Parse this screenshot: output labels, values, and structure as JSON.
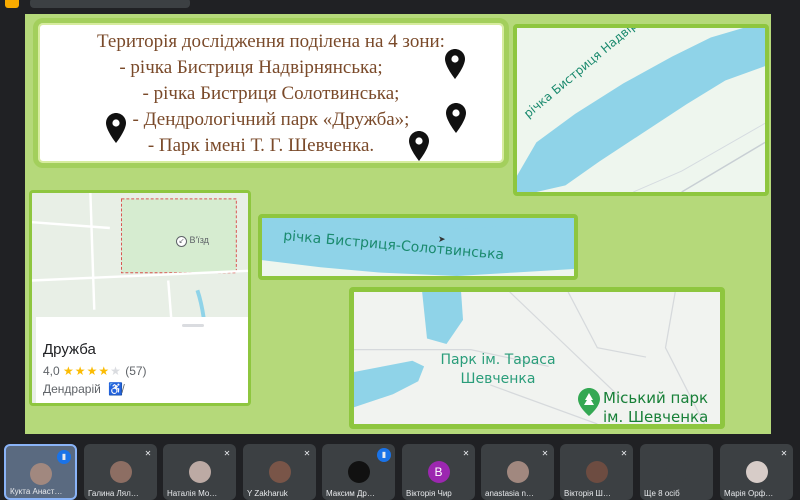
{
  "window": {
    "title": ""
  },
  "slide": {
    "heading": "Територія дослідження поділена на 4 зони:",
    "zones": [
      "- річка Бистриця Надвірнянська;",
      "- річка Бистриця Солотвинська;",
      "- Дендрологічний парк «Дружба»;",
      "- Парк імені Т. Г. Шевченка."
    ],
    "maps": {
      "river_nadvirnyanska": {
        "label": "річка Бистриця Надвірнянська"
      },
      "river_solotvynska": {
        "label": "річка Бистриця-Солотвинська"
      },
      "dendropark": {
        "entrance_label": "В'їзд",
        "card": {
          "name": "Дружба",
          "rating": "4,0",
          "review_count": "(57)",
          "category": "Дендрарій",
          "stars_filled": 4,
          "stars_total": 5
        }
      },
      "park_shevchenko": {
        "label_line1": "Парк ім. Тараса",
        "label_line2": "Шевченка",
        "poi_line1": "Міський парк",
        "poi_line2": "ім. Шевченка"
      }
    }
  },
  "participants": [
    {
      "name": "Кукта Анаст…",
      "initial": "",
      "mic": "on",
      "active": true,
      "avatar_color": "#a1887f"
    },
    {
      "name": "Галина Лял…",
      "initial": "",
      "mic": "off",
      "active": false,
      "avatar_color": "#8d6e63"
    },
    {
      "name": "Наталія Мо…",
      "initial": "",
      "mic": "off",
      "active": false,
      "avatar_color": "#bcaaa4"
    },
    {
      "name": "Y Zakharuk",
      "initial": "",
      "mic": "off",
      "active": false,
      "avatar_color": "#795548"
    },
    {
      "name": "Максим Др…",
      "initial": "",
      "mic": "on",
      "active": false,
      "avatar_color": "#111111"
    },
    {
      "name": "Вікторія Чир",
      "initial": "В",
      "mic": "off",
      "active": false,
      "avatar_color": "#9c27b0"
    },
    {
      "name": "anastasia n…",
      "initial": "",
      "mic": "off",
      "active": false,
      "avatar_color": "#a1887f"
    },
    {
      "name": "Вікторія Ш…",
      "initial": "",
      "mic": "off",
      "active": false,
      "avatar_color": "#6d4c41"
    },
    {
      "name": "Ще 8 осіб",
      "initial": "",
      "mic": "none",
      "active": false,
      "avatar_color": "#3c4043"
    },
    {
      "name": "Марія Орф…",
      "initial": "",
      "mic": "off",
      "active": false,
      "avatar_color": "#d7ccc8"
    }
  ],
  "colors": {
    "slide_bg": "#b5d97a",
    "frame_green": "#8ec63f",
    "heading_brown": "#7a4a2a",
    "river_blue": "#8fd3e8",
    "map_label_teal": "#1a8a6e",
    "meet_active_blue": "#8ab4f8"
  }
}
